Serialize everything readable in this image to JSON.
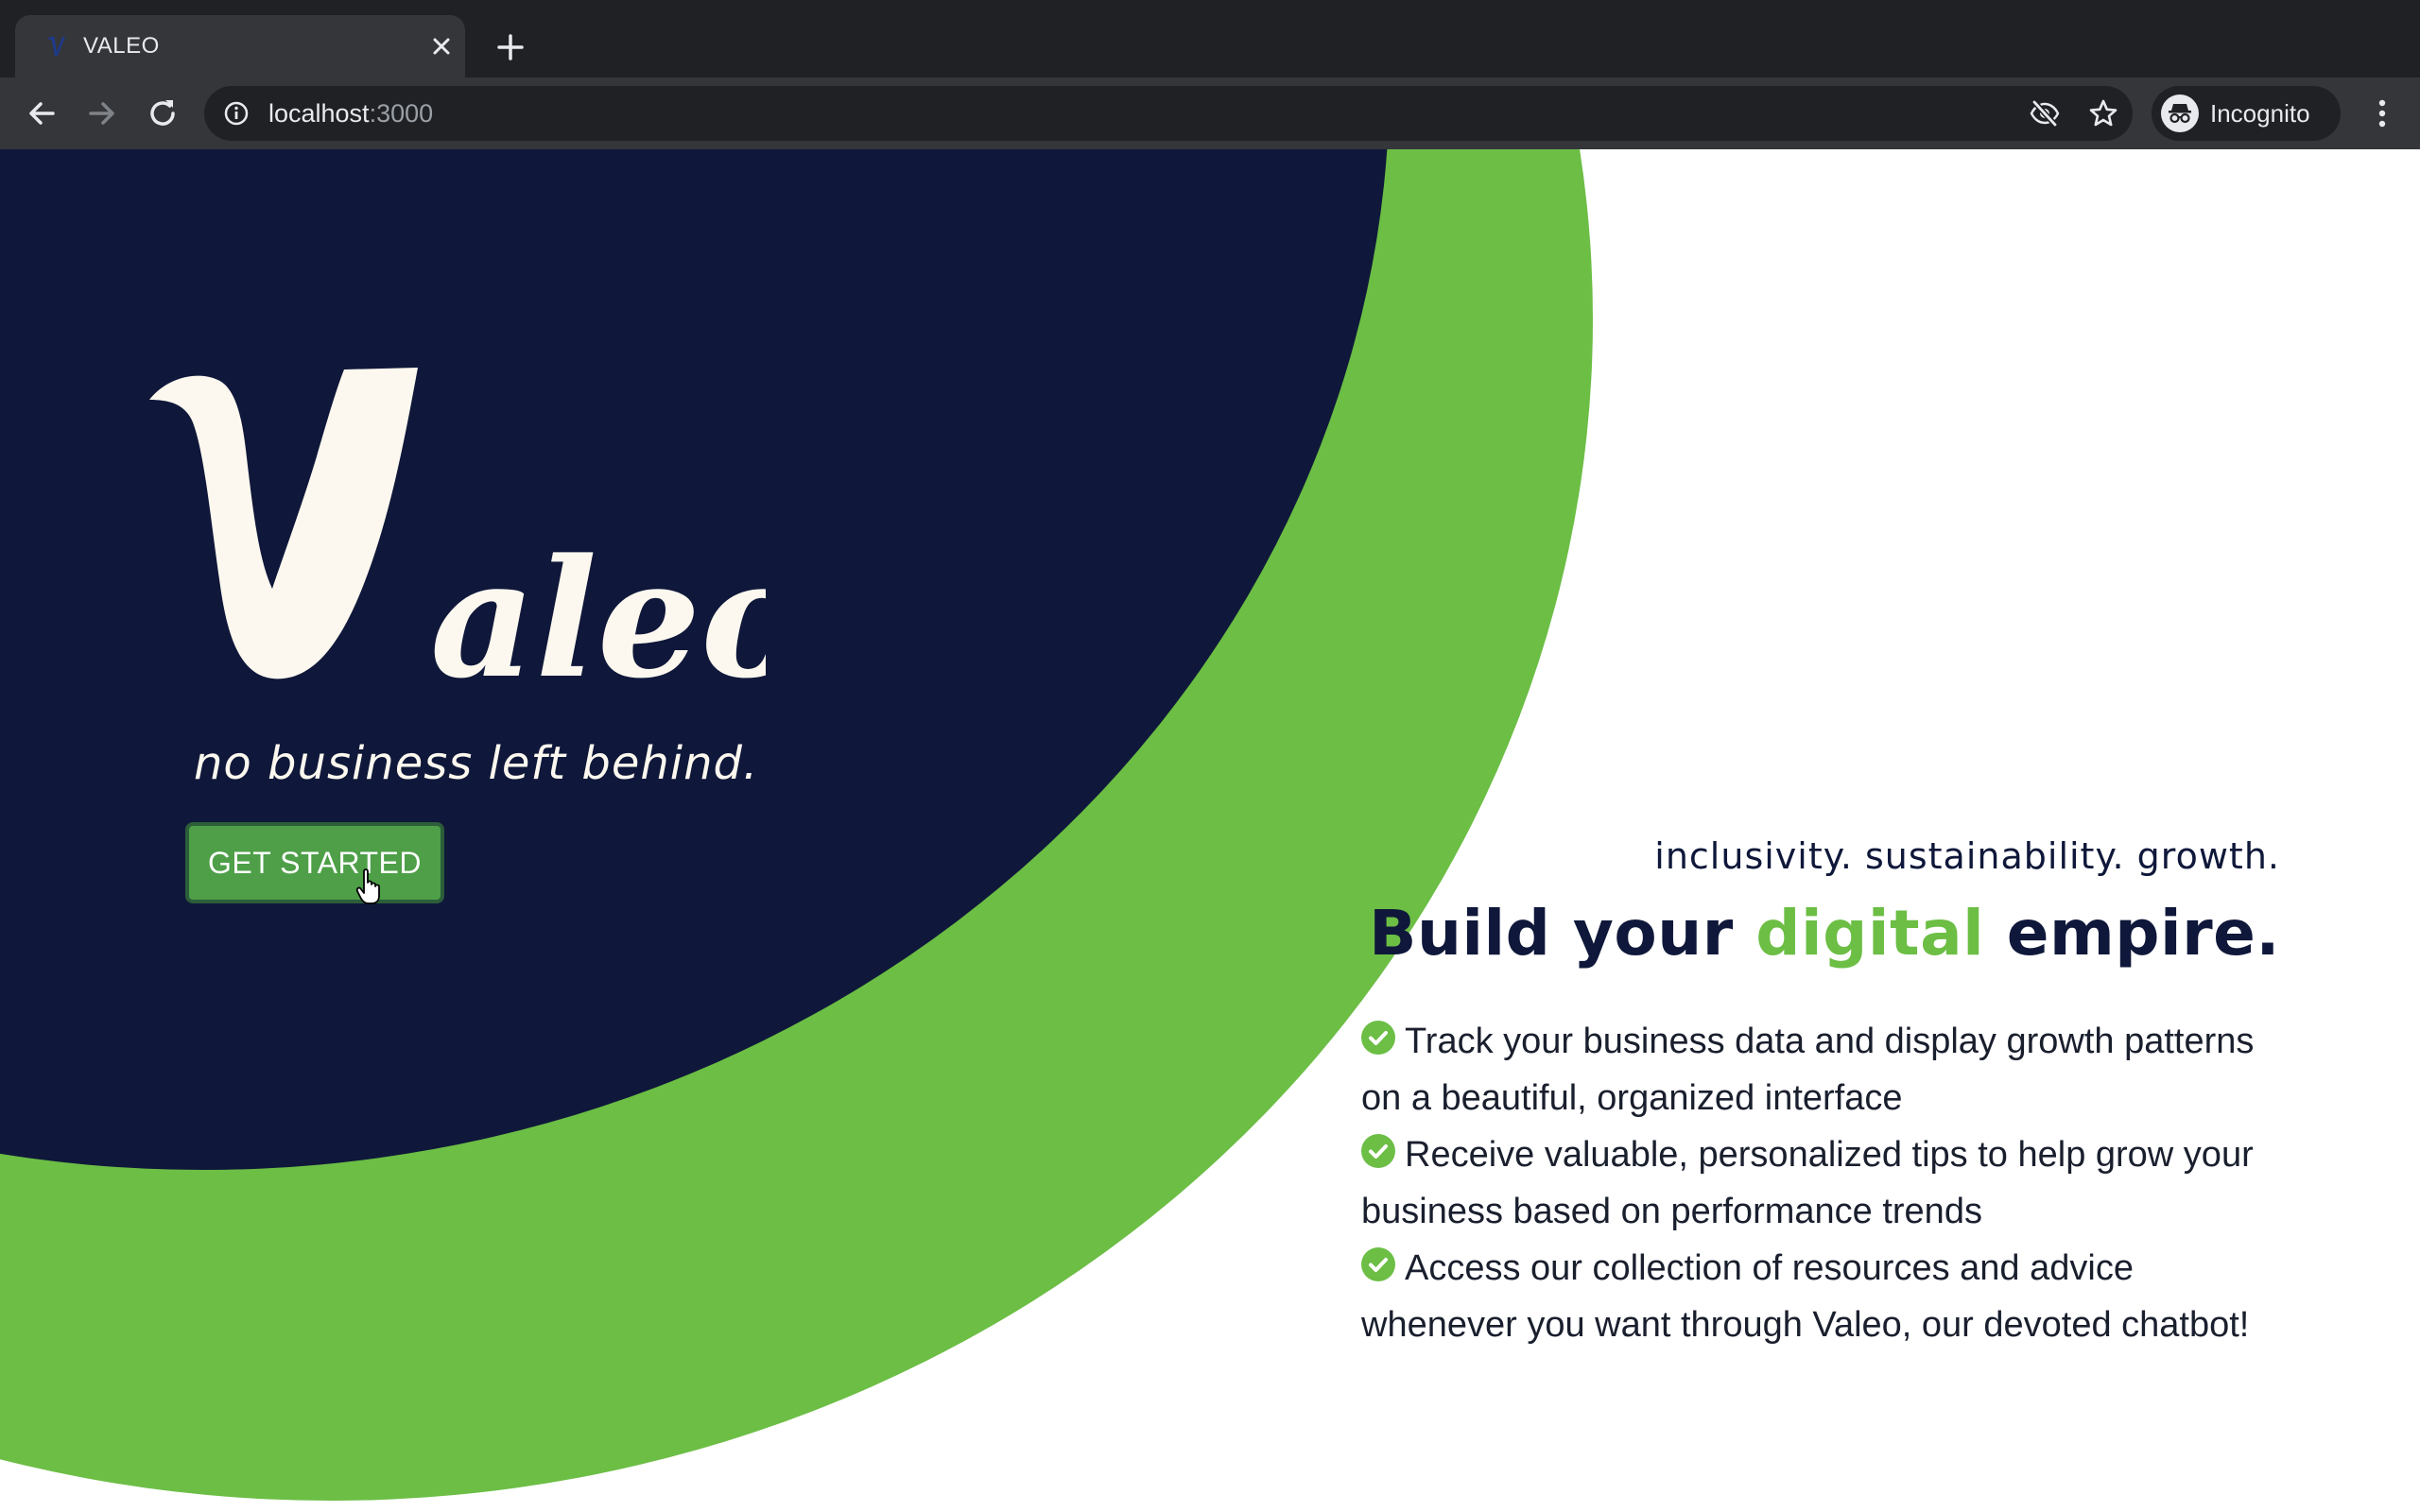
{
  "browser": {
    "tab_title": "VALEO",
    "url_host": "localhost",
    "url_port": ":3000",
    "profile_label": "Incognito",
    "icons": {
      "favicon": "valeo-favicon",
      "tab_close": "close-icon",
      "new_tab": "plus-icon",
      "back": "arrow-left-icon",
      "forward": "arrow-right-icon",
      "reload": "reload-icon",
      "site_info": "info-icon",
      "tracking": "eye-off-icon",
      "bookmark": "star-icon",
      "incognito": "incognito-icon",
      "menu": "kebab-menu-icon"
    }
  },
  "hero": {
    "logo_text": "Valeo",
    "tagline": "no business left behind.",
    "cta_label": "GET STARTED"
  },
  "content": {
    "kicker": "inclusivity. sustainability. growth.",
    "headline_before": "Build your ",
    "headline_accent": "digital",
    "headline_after": " empire.",
    "features": [
      "Track your business data and display growth patterns on a beautiful, organized interface",
      "Receive valuable, personalized tips to help grow your business based on performance trends",
      "Access our collection of resources and advice whenever you want through Valeo, our devoted chatbot!"
    ]
  },
  "colors": {
    "navy": "#0f183a",
    "green": "#6cbe45",
    "button_green": "#4e9f48",
    "cream": "#fdf8ef",
    "chrome_dark": "#202124",
    "chrome_toolbar": "#35363a"
  }
}
